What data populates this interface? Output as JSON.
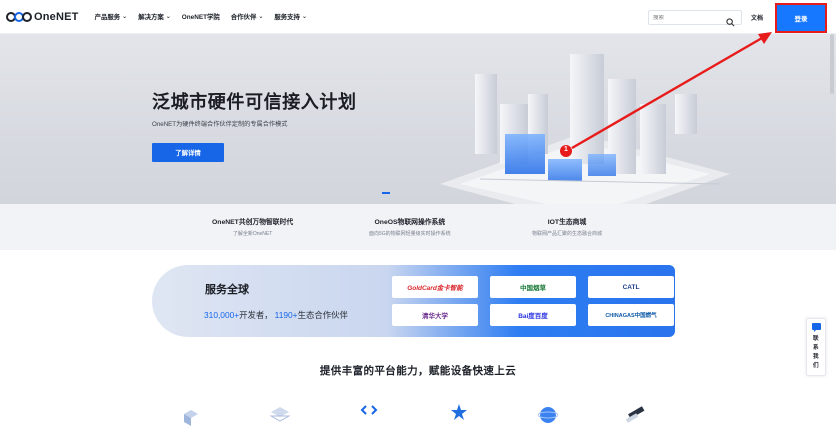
{
  "header": {
    "logo_text": "OneNET",
    "nav": [
      {
        "label": "产品服务",
        "has_menu": true
      },
      {
        "label": "解决方案",
        "has_menu": true
      },
      {
        "label": "OneNET学院",
        "has_menu": false
      },
      {
        "label": "合作伙伴",
        "has_menu": true
      },
      {
        "label": "服务支持",
        "has_menu": true
      }
    ],
    "search_placeholder": "搜索",
    "docs_label": "文档",
    "login_label": "登录"
  },
  "hero": {
    "title": "泛城市硬件可信接入计划",
    "subtitle": "OneNET为硬件终端合作伙伴定制的专属合作模式",
    "cta_label": "了解详情",
    "annotation_number": "1"
  },
  "features": [
    {
      "title": "OneNET共创万物智联时代",
      "desc": "了解全新OneNET"
    },
    {
      "title": "OneOS物联网操作系统",
      "desc": "面向5G的物联网轻量级实时操作系统"
    },
    {
      "title": "IOT生态商城",
      "desc": "物联网产品汇聚的生态融合商城"
    }
  ],
  "service": {
    "title": "服务全球",
    "developers": "310,000+",
    "developers_suffix": "开发者，",
    "partners": "1190+",
    "partners_suffix": "生态合作伙伴",
    "partner_logos": [
      {
        "label": "GoldCard金卡智能",
        "color": "#d9262c"
      },
      {
        "label": "中国烟草",
        "color": "#1a7a3a"
      },
      {
        "label": "CATL",
        "color": "#1e3f8a"
      },
      {
        "label": "清华大学",
        "color": "#6b2c8f"
      },
      {
        "label": "Bai度百度",
        "color": "#2932e1"
      },
      {
        "label": "CHINAGAS中国燃气",
        "color": "#0e5aa7"
      }
    ]
  },
  "platform_title": "提供丰富的平台能力，赋能设备快速上云",
  "contact_widget": "联系我们",
  "colors": {
    "brand_blue": "#1766e8",
    "login_blue": "#1677ff",
    "annotation_red": "#e81b1b"
  }
}
